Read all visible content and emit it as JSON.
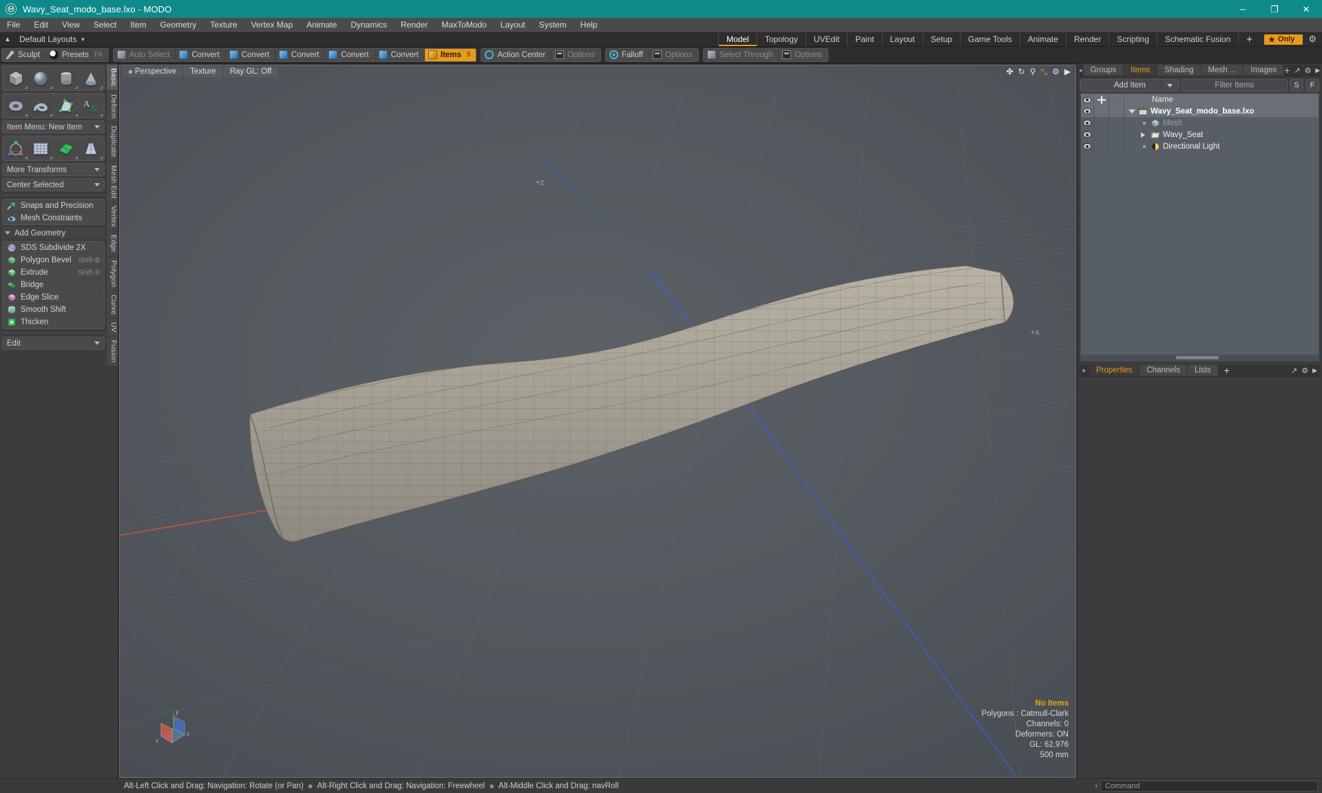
{
  "titlebar": {
    "title": "Wavy_Seat_modo_base.lxo - MODO",
    "logo_icon": "modo-logo-icon",
    "minimize": "─",
    "maximize": "❐",
    "close": "✕"
  },
  "menubar": {
    "items": [
      "File",
      "Edit",
      "View",
      "Select",
      "Item",
      "Geometry",
      "Texture",
      "Vertex Map",
      "Animate",
      "Dynamics",
      "Render",
      "MaxToModo",
      "Layout",
      "System",
      "Help"
    ]
  },
  "layoutbar": {
    "layouts_label": "Default Layouts",
    "tabs": [
      {
        "label": "Model",
        "active": true
      },
      {
        "label": "Topology",
        "active": false
      },
      {
        "label": "UVEdit",
        "active": false
      },
      {
        "label": "Paint",
        "active": false
      },
      {
        "label": "Layout",
        "active": false
      },
      {
        "label": "Setup",
        "active": false
      },
      {
        "label": "Game Tools",
        "active": false
      },
      {
        "label": "Animate",
        "active": false
      },
      {
        "label": "Render",
        "active": false
      },
      {
        "label": "Scripting",
        "active": false
      },
      {
        "label": "Schematic Fusion",
        "active": false
      }
    ],
    "add_tab_label": "+",
    "only_label": "Only",
    "only_star": "★",
    "gear_icon": "gear-icon"
  },
  "toolbar": {
    "groups": [
      {
        "cells": [
          {
            "label": "Sculpt",
            "icon": "sculpt-icon",
            "kbd": "",
            "state": "normal"
          },
          {
            "label": "Presets",
            "icon": "presets-icon",
            "kbd": "F6",
            "state": "normal"
          }
        ]
      },
      {
        "cells": [
          {
            "label": "Auto Select",
            "icon": "cube-gray-icon",
            "kbd": "",
            "state": "dim"
          },
          {
            "label": "Convert",
            "icon": "cube-blue-icon",
            "kbd": "",
            "state": "normal"
          },
          {
            "label": "Convert",
            "icon": "cube-blue-icon",
            "kbd": "",
            "state": "normal"
          },
          {
            "label": "Convert",
            "icon": "cube-blue-icon",
            "kbd": "",
            "state": "normal"
          },
          {
            "label": "Convert",
            "icon": "cube-blue-icon",
            "kbd": "",
            "state": "normal"
          },
          {
            "label": "Convert",
            "icon": "cube-blue-icon",
            "kbd": "",
            "state": "normal"
          },
          {
            "label": "Items",
            "icon": "cube-orange-icon",
            "kbd": "5",
            "state": "active"
          }
        ]
      },
      {
        "cells": [
          {
            "label": "Action Center",
            "icon": "action-center-icon",
            "kbd": "",
            "state": "normal"
          },
          {
            "label": "Options",
            "icon": "options-icon",
            "kbd": "",
            "state": "dim"
          }
        ]
      },
      {
        "cells": [
          {
            "label": "Falloff",
            "icon": "falloff-icon",
            "kbd": "",
            "state": "normal"
          },
          {
            "label": "Options",
            "icon": "options-icon",
            "kbd": "",
            "state": "dim"
          }
        ]
      },
      {
        "cells": [
          {
            "label": "Select Through",
            "icon": "select-through-icon",
            "kbd": "",
            "state": "dim"
          },
          {
            "label": "Options",
            "icon": "options-icon",
            "kbd": "",
            "state": "dim"
          }
        ]
      }
    ]
  },
  "leftpanel": {
    "primitives_row1": [
      {
        "name": "cube-primitive",
        "icon": "cube-icon"
      },
      {
        "name": "sphere-primitive",
        "icon": "sphere-icon"
      },
      {
        "name": "cylinder-primitive",
        "icon": "cylinder-icon"
      },
      {
        "name": "cone-primitive",
        "icon": "cone-icon"
      }
    ],
    "primitives_row2": [
      {
        "name": "torus-primitive",
        "icon": "torus-icon"
      },
      {
        "name": "spiral-primitive",
        "icon": "spiral-icon"
      },
      {
        "name": "polygon-primitive",
        "icon": "polygon-icon"
      },
      {
        "name": "text-primitive",
        "icon": "text-icon"
      }
    ],
    "item_menu": "Item Menu: New Item",
    "transforms_row": [
      {
        "name": "transform-gizmo",
        "icon": "move-gizmo-icon"
      },
      {
        "name": "mesh-grid",
        "icon": "mesh-grid-icon"
      },
      {
        "name": "bend-deform",
        "icon": "bend-icon"
      },
      {
        "name": "taper-deform",
        "icon": "taper-icon"
      }
    ],
    "more_transforms": "More Transforms",
    "center_selected": "Center Selected",
    "snaps": {
      "label": "Snaps and Precision",
      "icon": "snap-icon"
    },
    "constraints": {
      "label": "Mesh Constraints",
      "icon": "constraint-icon"
    },
    "add_geometry_header": "Add Geometry",
    "geometry_tools": [
      {
        "label": "SDS Subdivide 2X",
        "kbd": "",
        "icon": "subdivide-icon"
      },
      {
        "label": "Polygon Bevel",
        "kbd": "Shift-B",
        "icon": "bevel-icon"
      },
      {
        "label": "Extrude",
        "kbd": "Shift-X",
        "icon": "extrude-icon"
      },
      {
        "label": "Bridge",
        "kbd": "",
        "icon": "bridge-icon"
      },
      {
        "label": "Edge Slice",
        "kbd": "",
        "icon": "edge-slice-icon"
      },
      {
        "label": "Smooth Shift",
        "kbd": "",
        "icon": "smooth-shift-icon"
      },
      {
        "label": "Thicken",
        "kbd": "",
        "icon": "thicken-icon"
      }
    ],
    "edit_dropdown": "Edit",
    "vertical_tabs": [
      {
        "label": "Basic",
        "active": true
      },
      {
        "label": "Deform",
        "active": false
      },
      {
        "label": "Duplicate",
        "active": false
      },
      {
        "label": "Mesh Edit",
        "active": false
      },
      {
        "label": "Vertex",
        "active": false
      },
      {
        "label": "Edge",
        "active": false
      },
      {
        "label": "Polygon",
        "active": false
      },
      {
        "label": "Curve",
        "active": false
      },
      {
        "label": "UV",
        "active": false
      },
      {
        "label": "Fusion",
        "active": false
      }
    ]
  },
  "viewport": {
    "tabs": [
      {
        "label": "Perspective",
        "has_dot": true
      },
      {
        "label": "Texture",
        "has_dot": false
      },
      {
        "label": "Ray GL: Off",
        "has_dot": false
      }
    ],
    "icons": [
      {
        "name": "pan-icon",
        "glyph": "✤",
        "orange": false
      },
      {
        "name": "rotate-icon",
        "glyph": "↻",
        "orange": false
      },
      {
        "name": "zoom-icon",
        "glyph": "⚲",
        "orange": false
      },
      {
        "name": "fit-icon",
        "glyph": "⤡",
        "orange": true
      },
      {
        "name": "gear-icon",
        "glyph": "⚙",
        "orange": false
      },
      {
        "name": "chevron-right-icon",
        "glyph": "▶",
        "orange": false
      }
    ],
    "stats": {
      "selection": "No Items",
      "polygons": "Polygons : Catmull-Clark",
      "channels": "Channels: 0",
      "deformers": "Deformers: ON",
      "gl": "GL: 62,976",
      "scale": "500 mm"
    },
    "axis_labels": {
      "x": "x",
      "y": "y",
      "z": "z"
    },
    "plus_z_label": "+z"
  },
  "rightpanel": {
    "top_tabs": [
      {
        "label": "Groups",
        "active": false
      },
      {
        "label": "Items",
        "active": true
      },
      {
        "label": "Shading",
        "active": false
      },
      {
        "label": "Mesh ...",
        "active": false
      },
      {
        "label": "Images",
        "active": false
      }
    ],
    "top_tab_plus": "+",
    "add_item_label": "Add Item",
    "filter_placeholder": "Filter Items",
    "filter_value": "",
    "s_button": "S",
    "f_button": "F",
    "tree_columns": {
      "eye": "visibility-column",
      "lock": "lock-column",
      "axis": "axis-column",
      "name": "Name"
    },
    "tree_rows": [
      {
        "label": "Wavy_Seat_modo_base.lxo",
        "icon": "scene-icon",
        "indent": 0,
        "style": "bold",
        "expander": "down",
        "selected": true
      },
      {
        "label": "Mesh",
        "icon": "mesh-icon",
        "indent": 1,
        "style": "dim",
        "expander": "none",
        "selected": false
      },
      {
        "label": "Wavy_Seat",
        "icon": "folder-icon",
        "indent": 1,
        "style": "normal",
        "expander": "right",
        "selected": false
      },
      {
        "label": "Directional Light",
        "icon": "light-icon",
        "indent": 1,
        "style": "normal",
        "expander": "none",
        "selected": false
      }
    ],
    "bottom_tabs": [
      {
        "label": "Properties",
        "active": true
      },
      {
        "label": "Channels",
        "active": false
      },
      {
        "label": "Lists",
        "active": false
      }
    ],
    "bottom_tab_plus": "+"
  },
  "statusbar": {
    "hints": [
      "Alt-Left Click and Drag: Navigation: Rotate (or Pan)",
      "Alt-Right Click and Drag: Navigation: Freewheel",
      "Alt-Middle Click and Drag: navRoll"
    ],
    "separator": "●",
    "command_arrow": "›",
    "command_placeholder": "Command",
    "command_value": ""
  },
  "colors": {
    "title_bar": "#0e8a8a",
    "accent_orange": "#e89a1c",
    "panel_bg": "#3c3c3c",
    "viewport_bg": "#51575c",
    "tree_bg": "#585e66",
    "x_axis": "#c25b4a",
    "z_axis": "#3a5fd0",
    "y_axis": "#5aa84a"
  }
}
